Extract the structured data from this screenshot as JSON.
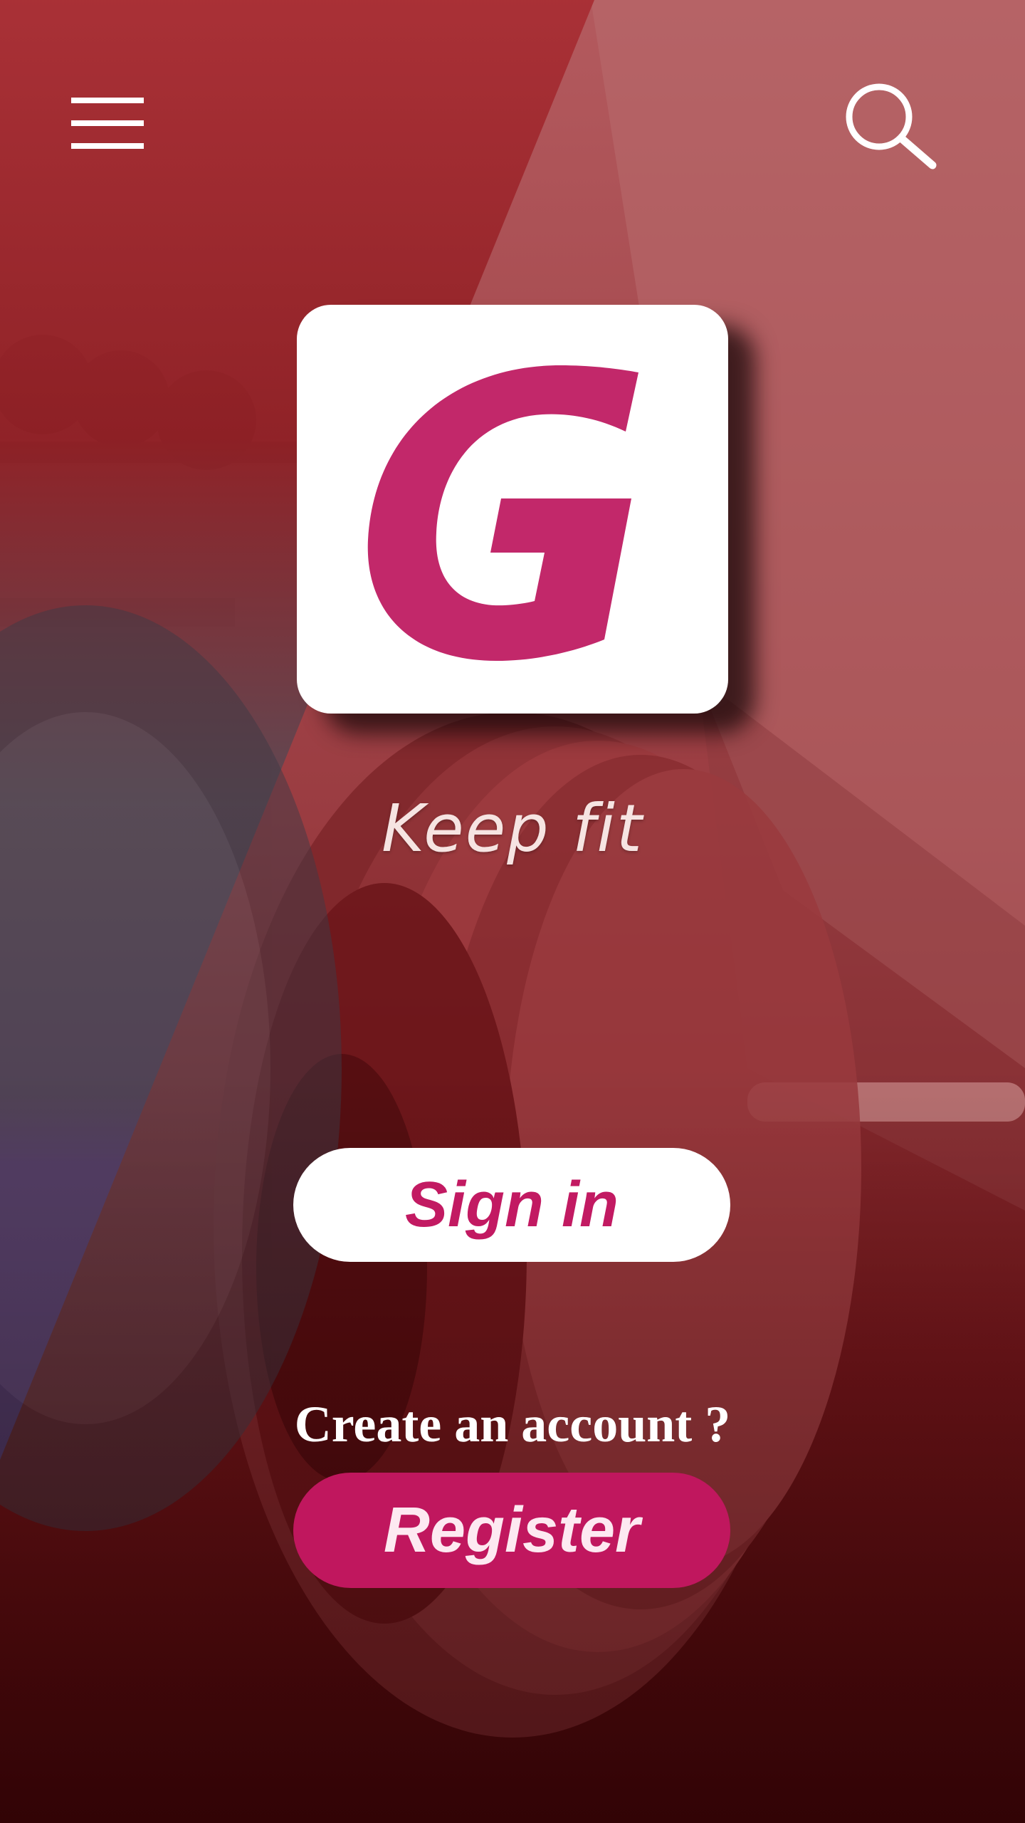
{
  "header": {
    "menu_icon": "hamburger-menu-icon",
    "search_icon": "search-icon"
  },
  "logo": {
    "letter": "G",
    "color": "#c2286a",
    "background": "#ffffff"
  },
  "tagline": "Keep fit",
  "signin": {
    "label": "Sign in",
    "text_color": "#c21a62",
    "background": "#ffffff"
  },
  "create_account_prompt": "Create an account ?",
  "register": {
    "label": "Register",
    "text_color": "#fde9f1",
    "background": "#c0175e"
  },
  "theme": {
    "primary_red": "#a82e33",
    "dark_red": "#5a0a0e"
  }
}
